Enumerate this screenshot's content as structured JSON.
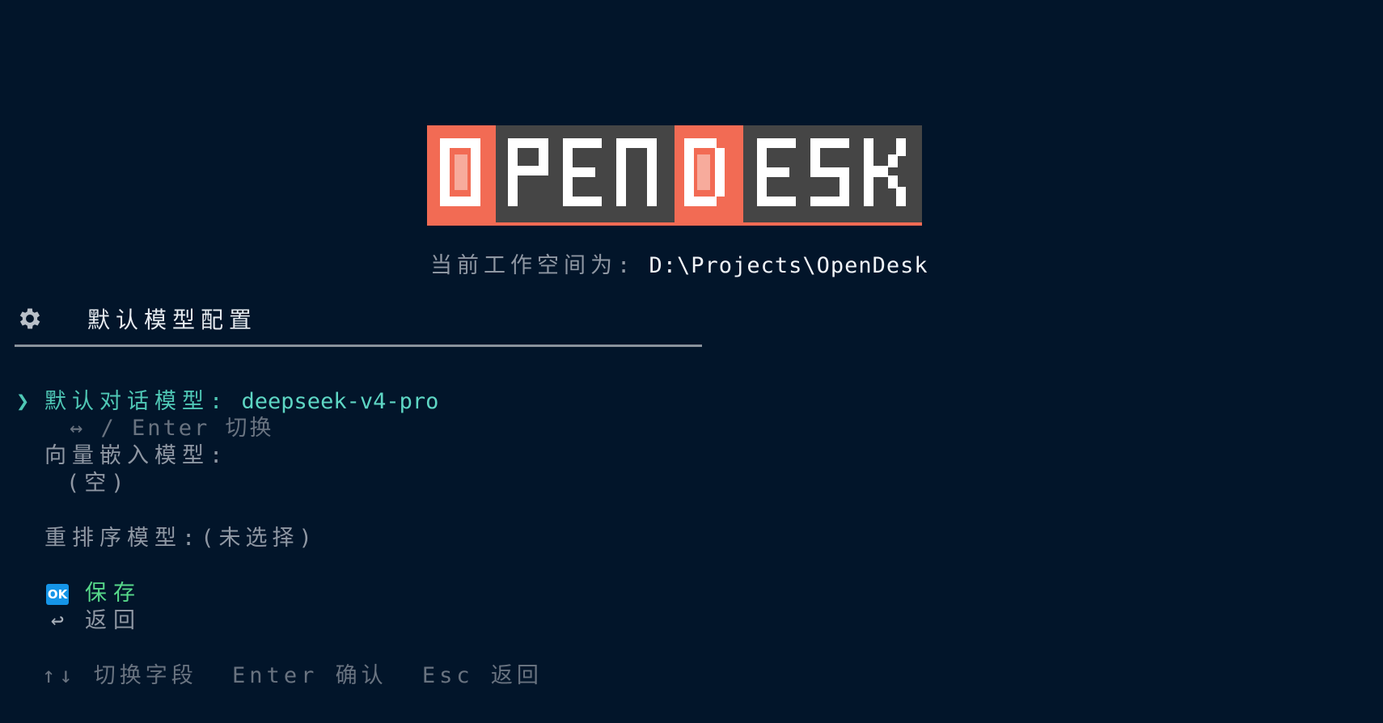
{
  "logo": {
    "text": "OPENDESK",
    "colors": {
      "accent": "#f26b54",
      "box": "#454545",
      "letters": "#ffffff"
    }
  },
  "workspace": {
    "label": "当前工作空间为:",
    "path": "D:\\Projects\\OpenDesk"
  },
  "section": {
    "icon": "gear-icon",
    "title": "默认模型配置"
  },
  "cursor": "❯",
  "fields": {
    "chat_model": {
      "label": "默认对话模型:",
      "value": "deepseek-v4-pro",
      "hint": "↔ / Enter 切换"
    },
    "embedding_model": {
      "label": "向量嵌入模型:",
      "value": "(空)"
    },
    "rerank_model": {
      "label": "重排序模型:",
      "value": "(未选择)"
    }
  },
  "actions": {
    "save": {
      "icon_text": "OK",
      "label": "保存"
    },
    "back": {
      "icon": "↩",
      "label": "返回"
    }
  },
  "footer": {
    "switch": "↑↓ 切换字段",
    "confirm": "Enter 确认",
    "escape": "Esc 返回"
  }
}
